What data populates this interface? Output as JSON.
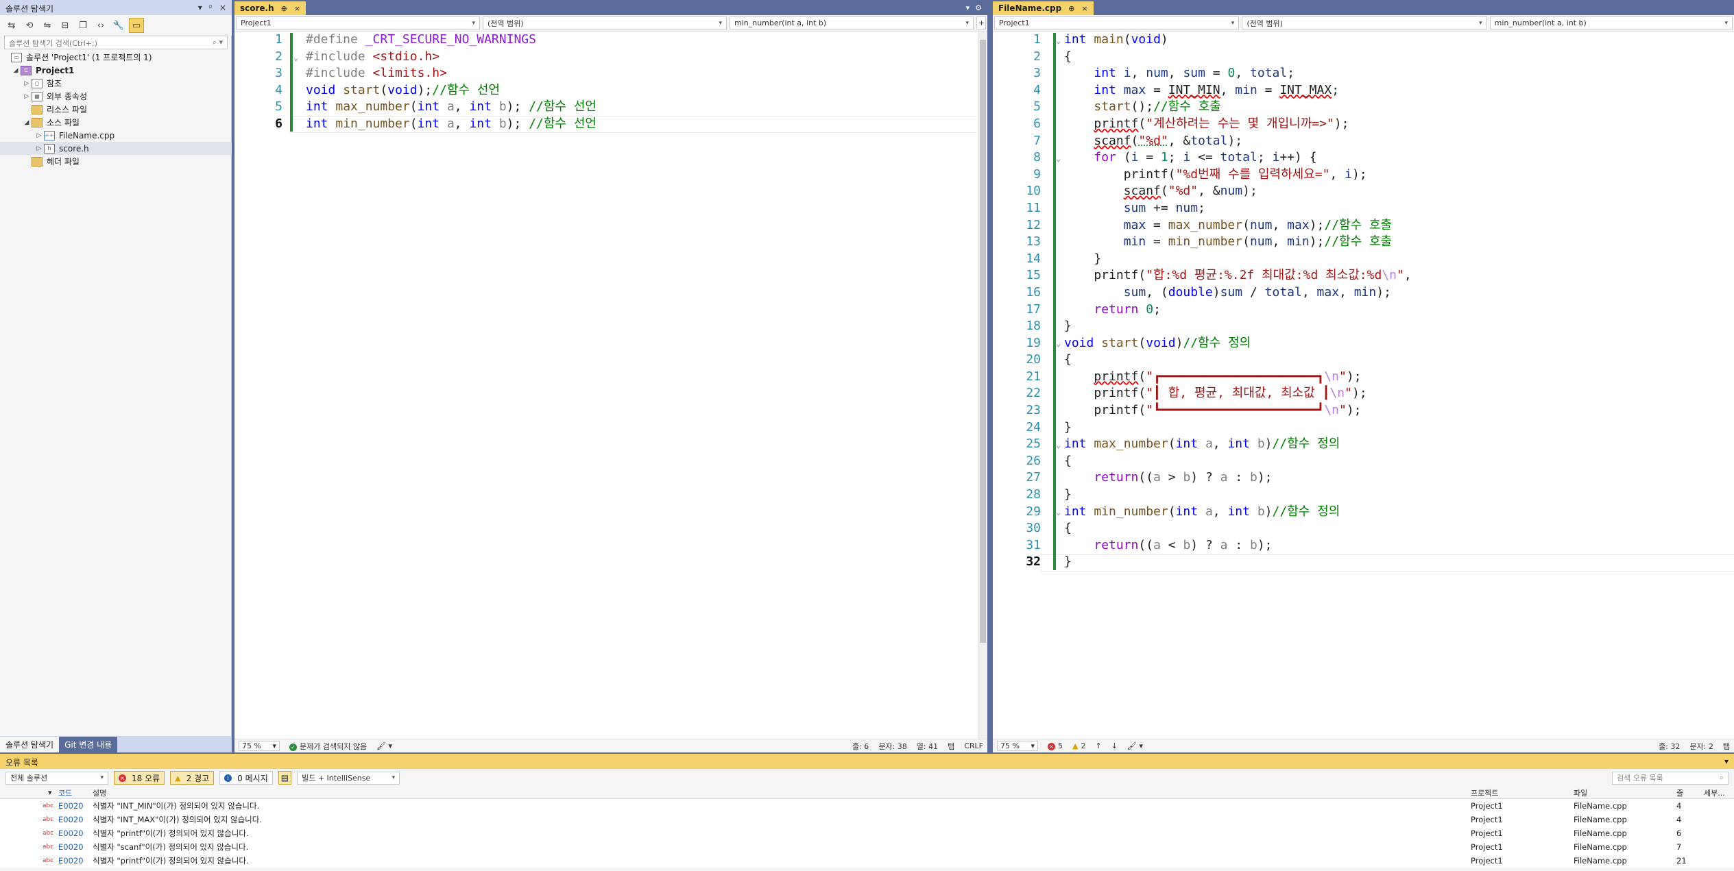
{
  "solution_explorer": {
    "title": "솔루션 탐색기",
    "title_controls": [
      "▾",
      "ᵖ",
      "×"
    ],
    "search_placeholder": "솔루션 탐색기 검색(Ctrl+;)",
    "tree": [
      {
        "label": "솔루션 'Project1' (1 프로젝트의 1)",
        "arrow": "",
        "icon": "▭"
      },
      {
        "label": "Project1",
        "arrow": "◢",
        "icon": "C"
      },
      {
        "label": "참조",
        "arrow": "▷",
        "icon": "○"
      },
      {
        "label": "외부 종속성",
        "arrow": "▷",
        "icon": "▦"
      },
      {
        "label": "리소스 파일",
        "arrow": "",
        "icon": ""
      },
      {
        "label": "소스 파일",
        "arrow": "◢",
        "icon": ""
      },
      {
        "label": "FileName.cpp",
        "arrow": "▷",
        "icon": "++"
      },
      {
        "label": "score.h",
        "arrow": "▷",
        "icon": "h"
      },
      {
        "label": "헤더 파일",
        "arrow": "",
        "icon": ""
      }
    ],
    "bottom_tabs": [
      "솔루션 탐색기",
      "Git 변경 내용"
    ]
  },
  "left_editor": {
    "tab": "score.h",
    "tab_pin": "⊕",
    "tab_close": "×",
    "nav": [
      "Project1",
      "(전역 범위)",
      "min_number(int a, int b)"
    ],
    "status": {
      "zoom": "75 %",
      "issues": "문제가 검색되지 않음",
      "line": "줄: 6",
      "char": "문자: 38",
      "col": "열: 41",
      "tab": "탭",
      "eol": "CRLF"
    }
  },
  "right_editor": {
    "tab": "FileName.cpp",
    "tab_pin": "⊕",
    "tab_close": "×",
    "nav": [
      "Project1",
      "(전역 범위)",
      "min_number(int a, int b)"
    ],
    "status": {
      "zoom": "75 %",
      "errors": "5",
      "warnings": "2",
      "line": "줄: 32",
      "char": "문자: 2",
      "tab": "탭"
    }
  },
  "error_list": {
    "title": "오류 목록",
    "scope": "전체 솔루션",
    "errors_btn": "18 오류",
    "warnings_btn": "2 경고",
    "messages_btn": "0 메시지",
    "build_filter": "빌드 + IntelliSense",
    "search_placeholder": "검색 오류 목록",
    "columns": [
      "코드",
      "설명",
      "프로젝트",
      "파일",
      "줄",
      "세부..."
    ],
    "rows": [
      {
        "code": "E0020",
        "desc": "식별자 \"INT_MIN\"이(가) 정의되어 있지 않습니다.",
        "project": "Project1",
        "file": "FileName.cpp",
        "line": "4"
      },
      {
        "code": "E0020",
        "desc": "식별자 \"INT_MAX\"이(가) 정의되어 있지 않습니다.",
        "project": "Project1",
        "file": "FileName.cpp",
        "line": "4"
      },
      {
        "code": "E0020",
        "desc": "식별자 \"printf\"이(가) 정의되어 있지 않습니다.",
        "project": "Project1",
        "file": "FileName.cpp",
        "line": "6"
      },
      {
        "code": "E0020",
        "desc": "식별자 \"scanf\"이(가) 정의되어 있지 않습니다.",
        "project": "Project1",
        "file": "FileName.cpp",
        "line": "7"
      },
      {
        "code": "E0020",
        "desc": "식별자 \"printf\"이(가) 정의되어 있지 않습니다.",
        "project": "Project1",
        "file": "FileName.cpp",
        "line": "21"
      }
    ]
  },
  "code_left": [
    "#define _CRT_SECURE_NO_WARNINGS",
    "#include <stdio.h>",
    "#include <limits.h>",
    "void start(void);//함수 선언",
    "int max_number(int a, int b); //함수 선언",
    "int min_number(int a, int b); //함수 선언"
  ],
  "code_right": [
    "int main(void)",
    "{",
    "    int i, num, sum = 0, total;",
    "    int max = INT_MIN, min = INT_MAX;",
    "    start();//함수 호출",
    "    printf(\"계산하려는 수는 몇 개입니까=>\");",
    "    scanf(\"%d\", &total);",
    "    for (i = 1; i <= total; i++) {",
    "        printf(\"%d번째 수를 입력하세요=\", i);",
    "        scanf(\"%d\", &num);",
    "        sum += num;",
    "        max = max_number(num, max);//함수 호출",
    "        min = min_number(num, min);//함수 호출",
    "    }",
    "    printf(\"합:%d 평균:%.2f 최대값:%d 최소값:%d\\n\",",
    "        sum, (double)sum / total, max, min);",
    "    return 0;",
    "}",
    "void start(void)//함수 정의",
    "{",
    "    printf(\"┏━━━━━━━━━━━━━━━━━━━━━┓\\n\");",
    "    printf(\"┃ 합, 평균, 최대값, 최소값 ┃\\n\");",
    "    printf(\"┗━━━━━━━━━━━━━━━━━━━━━┛\\n\");",
    "}",
    "int max_number(int a, int b)//함수 정의",
    "{",
    "    return((a > b) ? a : b);",
    "}",
    "int min_number(int a, int b)//함수 정의",
    "{",
    "    return((a < b) ? a : b);",
    "}"
  ],
  "colors": {
    "accent_tab": "#f6d36a",
    "chrome": "#5a6c9a",
    "keyword": "#0000ff",
    "string": "#a31515",
    "comment": "#008000",
    "line_number": "#2b91af"
  }
}
